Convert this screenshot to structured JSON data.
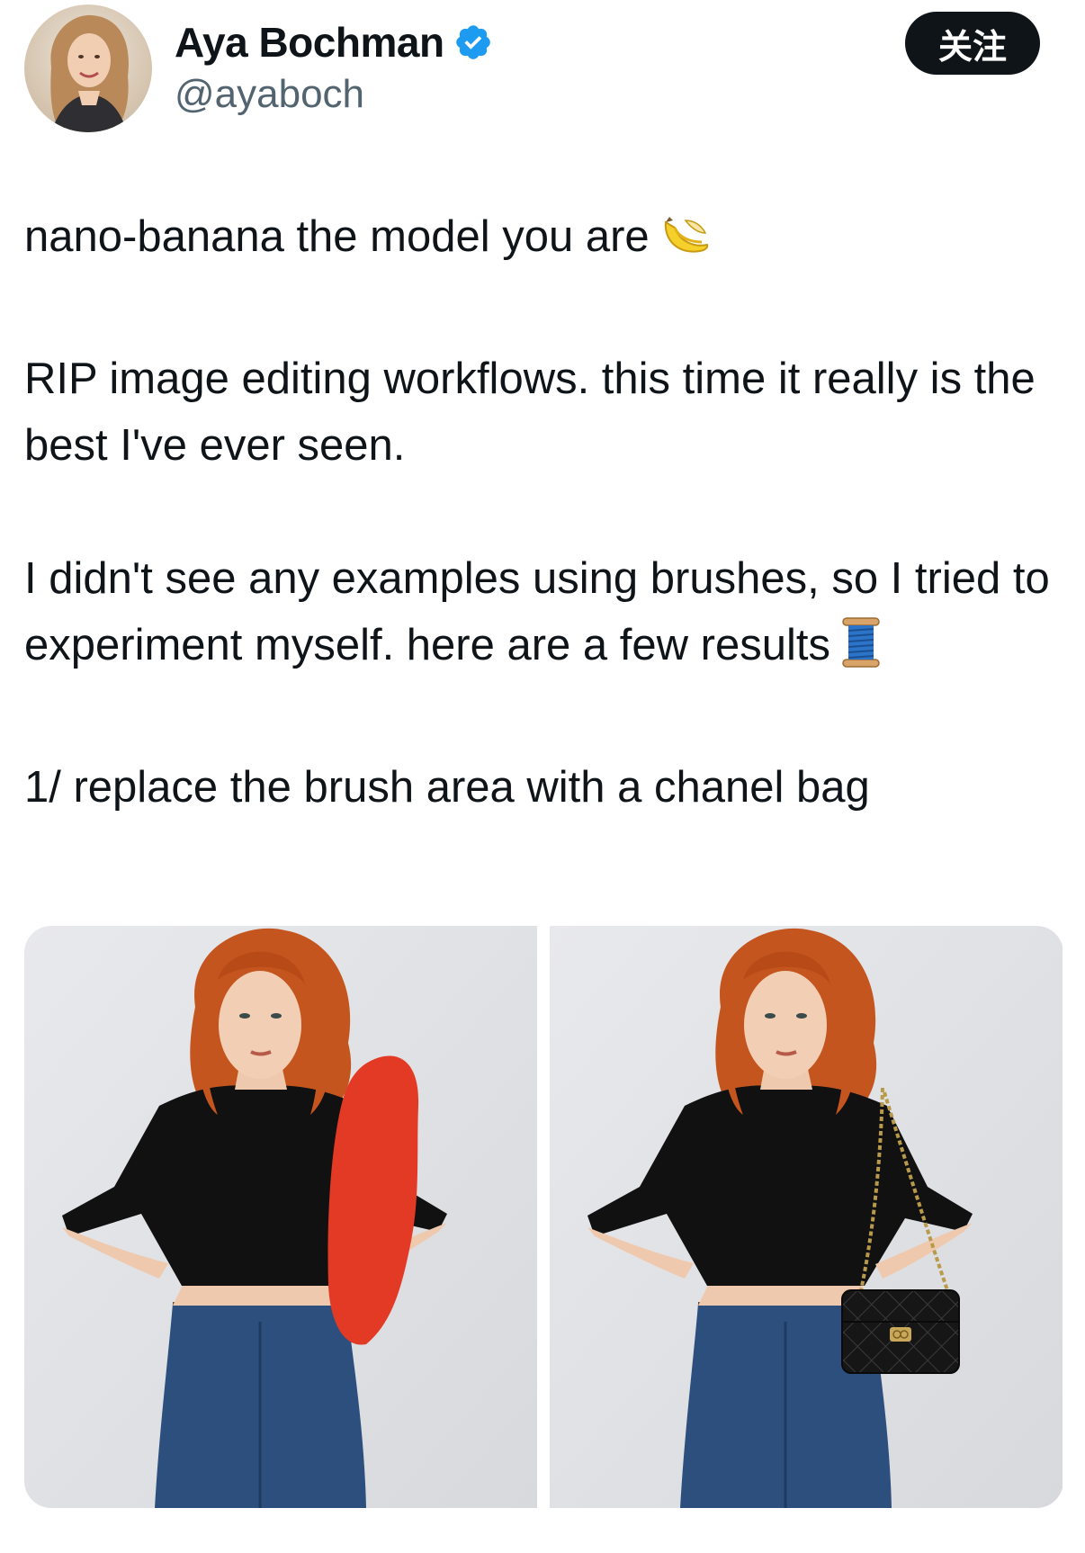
{
  "author": {
    "display_name": "Aya Bochman",
    "handle": "@ayaboch",
    "verified": true,
    "avatar_icon": "avatar-photo"
  },
  "follow_button": {
    "label": "关注"
  },
  "tweet": {
    "paragraph_1": "nano-banana the model you are",
    "paragraph_1_emoji": "banana-icon",
    "paragraph_2": "RIP image editing workflows. this time it really is the best I've ever seen.",
    "paragraph_3": "I didn't see any examples using brushes, so I tried to experiment myself. here are a few results",
    "paragraph_3_emoji": "thread-spool-icon",
    "paragraph_4": "1/ replace the brush area with a chanel bag"
  },
  "media": {
    "images": [
      {
        "name": "original-with-red-brush-mask",
        "mask_color": "#e23a25"
      },
      {
        "name": "edited-with-chanel-bag",
        "bag_color": "#161616"
      }
    ]
  },
  "colors": {
    "text_primary": "#0f1419",
    "text_secondary": "#536471",
    "verified_blue": "#1d9bf0",
    "follow_bg": "#0f1419"
  }
}
